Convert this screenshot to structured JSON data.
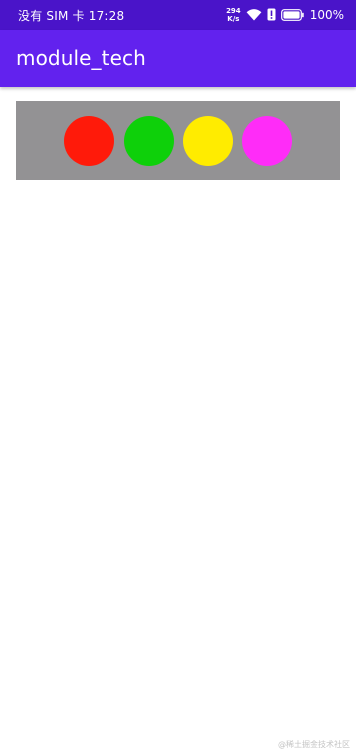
{
  "status_bar": {
    "carrier_time": "没有 SIM 卡 17:28",
    "net_speed_value": "294",
    "net_speed_unit": "K/s",
    "battery": "100%"
  },
  "app_bar": {
    "title": "module_tech"
  },
  "lights": [
    {
      "name": "red",
      "color": "#ff1a0a"
    },
    {
      "name": "green",
      "color": "#0ed00a"
    },
    {
      "name": "yellow",
      "color": "#ffec00"
    },
    {
      "name": "magenta",
      "color": "#ff2cf8"
    }
  ],
  "panel_color": "#939294",
  "watermark": "@稀土掘金技术社区"
}
